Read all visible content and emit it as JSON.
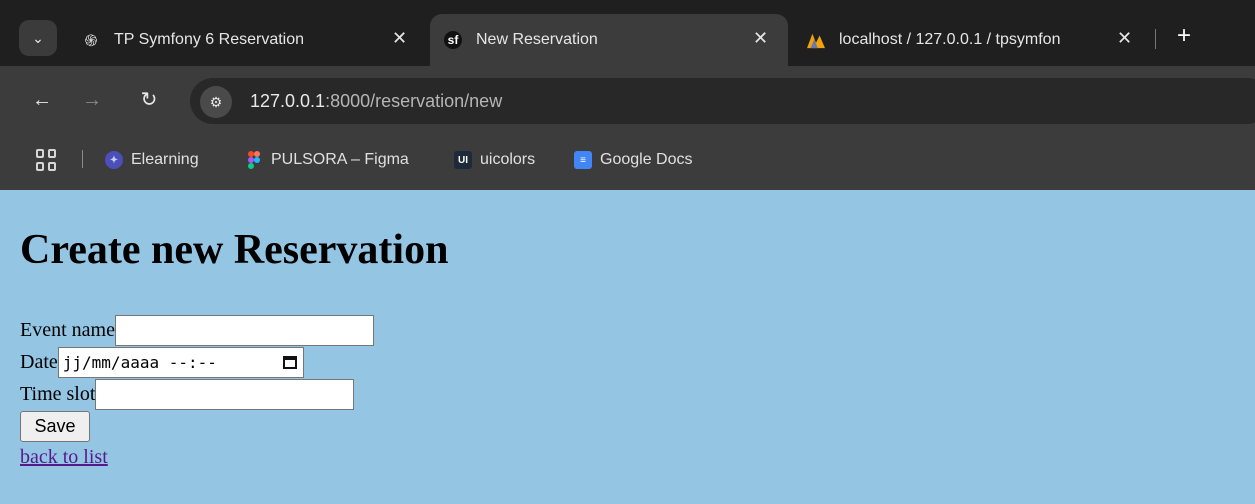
{
  "browser": {
    "tabs": [
      {
        "title": "TP Symfony 6 Reservation",
        "favicon": "openai-icon"
      },
      {
        "title": "New Reservation",
        "favicon": "symfony-icon",
        "favicon_text": "sf"
      },
      {
        "title": "localhost / 127.0.0.1 / tpsymfon",
        "favicon": "phpmyadmin-icon"
      }
    ],
    "url_host": "127.0.0.1",
    "url_path": ":8000/reservation/new",
    "bookmarks": [
      {
        "label": "Elearning",
        "icon": "elearning-icon"
      },
      {
        "label": "PULSORA – Figma",
        "icon": "figma-icon"
      },
      {
        "label": "uicolors",
        "icon": "uicolors-icon",
        "icon_text": "UI"
      },
      {
        "label": "Google Docs",
        "icon": "google-docs-icon"
      }
    ]
  },
  "page": {
    "title": "Create new Reservation",
    "fields": {
      "event_name_label": "Event name",
      "event_name_value": "",
      "date_label": "Date",
      "date_placeholder": "jj/mm/aaaa --:--",
      "time_slot_label": "Time slot",
      "time_slot_value": ""
    },
    "save_label": "Save",
    "back_link": "back to list"
  },
  "colors": {
    "page_background": "#94c6e4",
    "chrome_dark": "#1f1f1f",
    "chrome_toolbar": "#3c3c3c",
    "link_visited": "#551a8b"
  }
}
